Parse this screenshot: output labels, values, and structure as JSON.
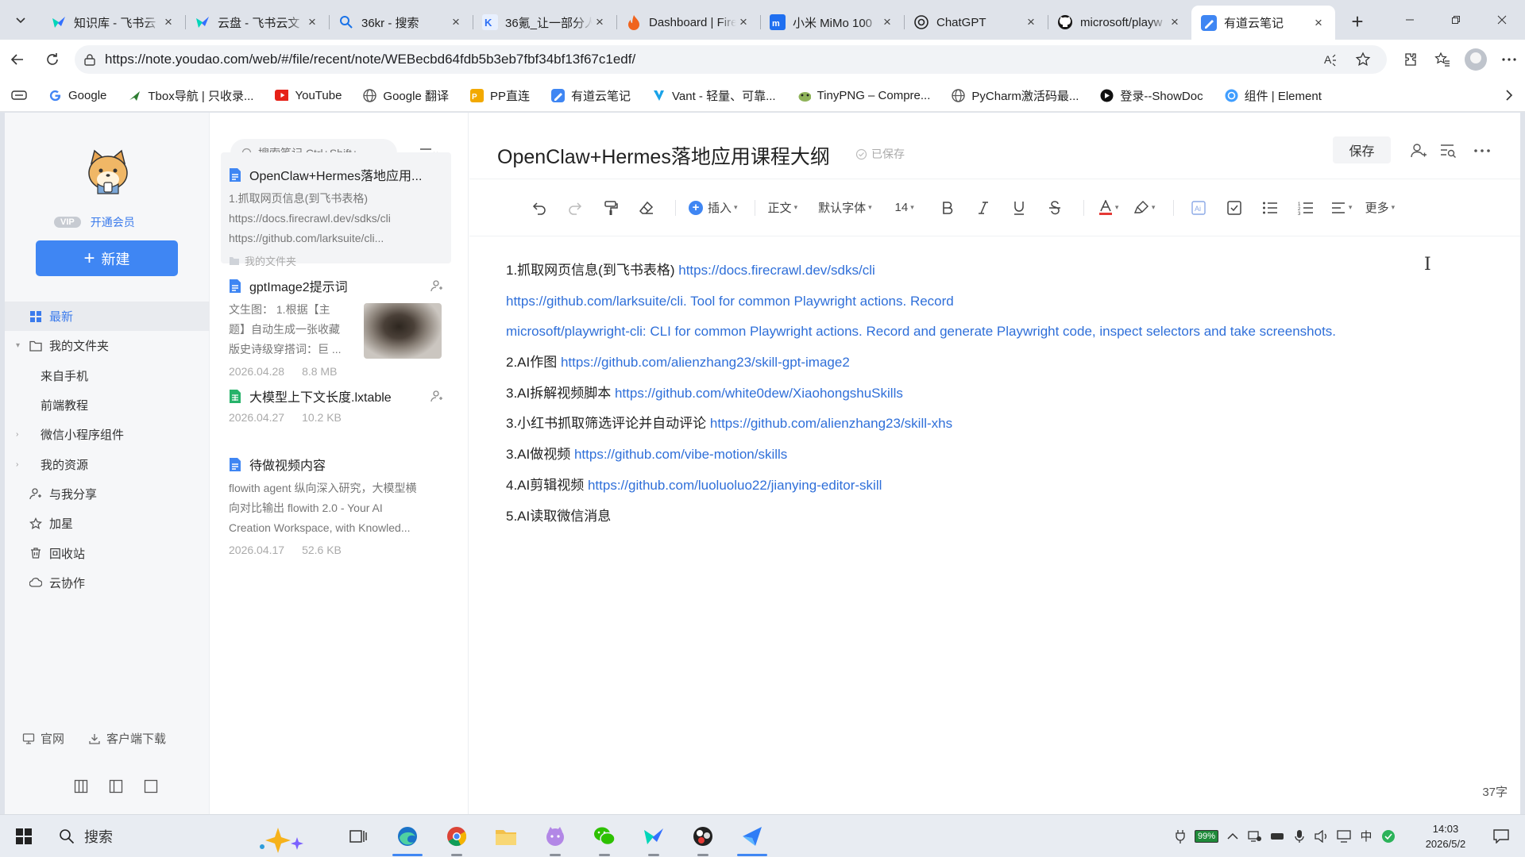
{
  "tabs": [
    {
      "title": "知识库 - 飞书云",
      "fav": "feishu"
    },
    {
      "title": "云盘 - 飞书云文",
      "fav": "feishu"
    },
    {
      "title": "36kr - 搜索",
      "fav": "search"
    },
    {
      "title": "36氪_让一部分人",
      "fav": "36kr"
    },
    {
      "title": "Dashboard | Fire",
      "fav": "firecrawl"
    },
    {
      "title": "小米 MiMo 100",
      "fav": "mimo"
    },
    {
      "title": "ChatGPT",
      "fav": "chatgpt"
    },
    {
      "title": "microsoft/playw",
      "fav": "github"
    },
    {
      "title": "有道云笔记",
      "fav": "youdao"
    }
  ],
  "address": {
    "url": "https://note.youdao.com/web/#/file/recent/note/WEBecbd64fdb5b3eb7fbf34bf13f67c1edf/"
  },
  "bookmarks": [
    {
      "label": "Google",
      "color": "#4285f4"
    },
    {
      "label": "Tbox导航 | 只收录...",
      "color": "#2e7d32"
    },
    {
      "label": "YouTube",
      "color": "#e62117"
    },
    {
      "label": "Google 翻译",
      "color": "#555555"
    },
    {
      "label": "PP直连",
      "color": "#f2a900"
    },
    {
      "label": "有道云笔记",
      "color": "#3f86f3"
    },
    {
      "label": "Vant - 轻量、可靠...",
      "color": "#1aa3e8"
    },
    {
      "label": "TinyPNG – Compre...",
      "color": "#6b8e23"
    },
    {
      "label": "PyCharm激活码最...",
      "color": "#555555"
    },
    {
      "label": "登录--ShowDoc",
      "color": "#111111"
    },
    {
      "label": "组件 | Element",
      "color": "#409eff"
    }
  ],
  "sidebar": {
    "vip_badge": "VIP",
    "vip_link": "开通会员",
    "new_button": "新建",
    "items": [
      {
        "label": "最新",
        "icon": "grid-icon",
        "active": true
      },
      {
        "label": "我的文件夹",
        "icon": "folder-icon",
        "caret": "▾"
      },
      {
        "label": "来自手机",
        "sub": true
      },
      {
        "label": "前端教程",
        "sub": true
      },
      {
        "label": "微信小程序组件",
        "caret": "›",
        "sub2": true
      },
      {
        "label": "我的资源",
        "caret": "›",
        "sub2": true
      },
      {
        "label": "与我分享",
        "icon": "share-user-icon"
      },
      {
        "label": "加星",
        "icon": "star-icon"
      },
      {
        "label": "回收站",
        "icon": "trash-icon"
      },
      {
        "label": "云协作",
        "icon": "cloud-icon"
      }
    ],
    "official_site": "官网",
    "client_download": "客户端下载"
  },
  "list": {
    "search_placeholder": "搜索笔记 Ctrl+Shift+",
    "cards": [
      {
        "title": "OpenClaw+Hermes落地应用...",
        "lines": [
          "1.抓取网页信息(到飞书表格)",
          "https://docs.firecrawl.dev/sdks/cli",
          "https://github.com/larksuite/cli..."
        ],
        "folder": "我的文件夹",
        "icon_color": "#3f86f3"
      },
      {
        "title": "gptImage2提示词",
        "lines": [
          "文生图：  1.根据【主",
          "题】自动生成一张收藏",
          "版史诗级穿搭词：巨 ..."
        ],
        "date": "2026.04.28",
        "size": "8.8 MB",
        "icon_color": "#3f86f3"
      },
      {
        "title": "大模型上下文长度.lxtable",
        "date": "2026.04.27",
        "size": "10.2 KB",
        "icon_color": "#27b36a"
      },
      {
        "title": "待做视频内容",
        "lines": [
          "flowith agent 纵向深入研究，大模型横",
          "向对比输出 flowith 2.0 - Your AI",
          "Creation Workspace, with Knowled..."
        ],
        "date": "2026.04.17",
        "size": "52.6 KB",
        "icon_color": "#3f86f3"
      }
    ]
  },
  "editor": {
    "title": "OpenClaw+Hermes落地应用课程大纲",
    "saved": "已保存",
    "save_button": "保存",
    "toolbar": {
      "insert": "插入",
      "style": "正文",
      "font": "默认字体",
      "size": "14",
      "more": "更多"
    },
    "word_count": "37字",
    "paragraphs": [
      {
        "text": "1.抓取网页信息(到飞书表格) ",
        "link": "https://docs.firecrawl.dev/sdks/cli"
      },
      {
        "text": " ",
        "link": "https://github.com/larksuite/cli.  Tool for common  Playwright actions. Record"
      },
      {
        "text": "",
        "link": "microsoft/playwright-cli: CLI for common Playwright actions. Record and generate Playwright code, inspect selectors and take screenshots."
      },
      {
        "text": "2.AI作图 ",
        "link": "https://github.com/alienzhang23/skill-gpt-image2"
      },
      {
        "text": "3.AI拆解视频脚本 ",
        "link": "https://github.com/white0dew/XiaohongshuSkills"
      },
      {
        "text": "3.小红书抓取筛选评论并自动评论 ",
        "link": "https://github.com/alienzhang23/skill-xhs"
      },
      {
        "text": "3.AI做视频  ",
        "link": "https://github.com/vibe-motion/skills"
      },
      {
        "text": "4.AI剪辑视频  ",
        "link": "https://github.com/luoluoluo22/jianying-editor-skill"
      },
      {
        "text": "5.AI读取微信消息",
        "link": ""
      }
    ]
  },
  "taskbar": {
    "search_label": "搜索",
    "battery": "99%",
    "ime": "中",
    "time": "14:03",
    "date": "2026/5/2"
  }
}
